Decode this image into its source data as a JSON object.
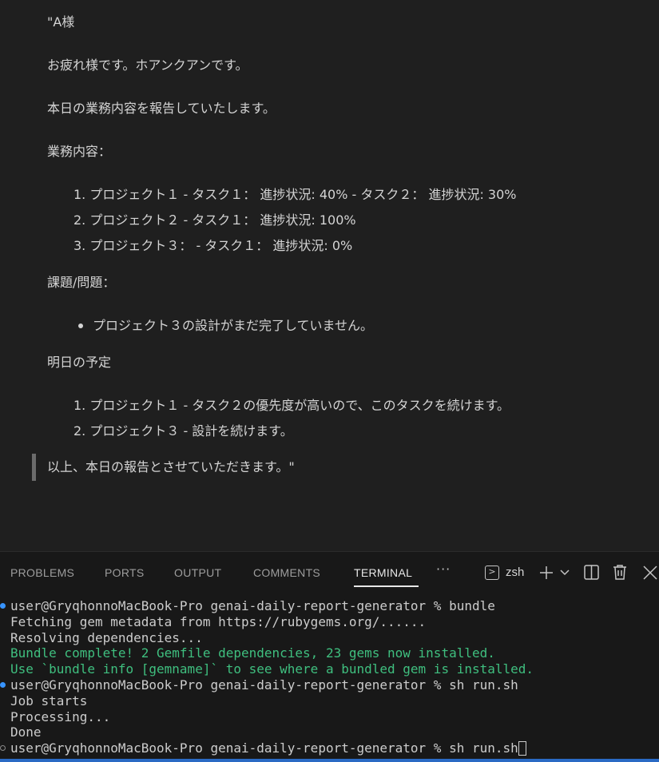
{
  "preview": {
    "greeting": "\"A様",
    "intro": "お疲れ様です。ホアンクアンです。",
    "report_line": "本日の業務内容を報告していたします。",
    "tasks_heading": "業務内容：",
    "tasks": [
      "1. プロジェクト１ - タスク１： 進捗状況: 40% - タスク２： 進捗状況: 30%",
      "2. プロジェクト２ - タスク１： 進捗状況: 100%",
      "3. プロジェクト３： - タスク１： 進捗状況: 0%"
    ],
    "issues_heading": "課題/問題：",
    "issues": [
      "プロジェクト３の設計がまだ完了していません。"
    ],
    "plan_heading": "明日の予定",
    "plans": [
      "1. プロジェクト１ - タスク２の優先度が高いので、このタスクを続けます。",
      "2. プロジェクト３ - 設計を続けます。"
    ],
    "closing": "以上、本日の報告とさせていただきます。\""
  },
  "panel": {
    "tabs": [
      "PROBLEMS",
      "PORTS",
      "OUTPUT",
      "COMMENTS",
      "TERMINAL"
    ],
    "active_tab": "TERMINAL",
    "more_label": "···",
    "shell_name": "zsh",
    "icons": [
      "terminal-icon",
      "add-icon",
      "chevron-down-icon",
      "split-icon",
      "trash-icon",
      "more-icon"
    ]
  },
  "terminal": {
    "lines": [
      "user@GryqhonnoMacBook-Pro genai-daily-report-generator % bundle",
      "Fetching gem metadata from https://rubygems.org/......",
      "Resolving dependencies...",
      "Bundle complete! 2 Gemfile dependencies, 23 gems now installed.",
      "Use `bundle info [gemname]` to see where a bundled gem is installed.",
      "user@GryqhonnoMacBook-Pro genai-daily-report-generator % sh run.sh",
      "Job starts",
      "Processing...",
      "Done",
      "user@GryqhonnoMacBook-Pro genai-daily-report-generator % sh run.sh"
    ]
  },
  "colors": {
    "background": "#1f1f1f",
    "panel": "#181818",
    "success_text": "#3fbf7f",
    "prompt_marker": "#3794ff"
  }
}
